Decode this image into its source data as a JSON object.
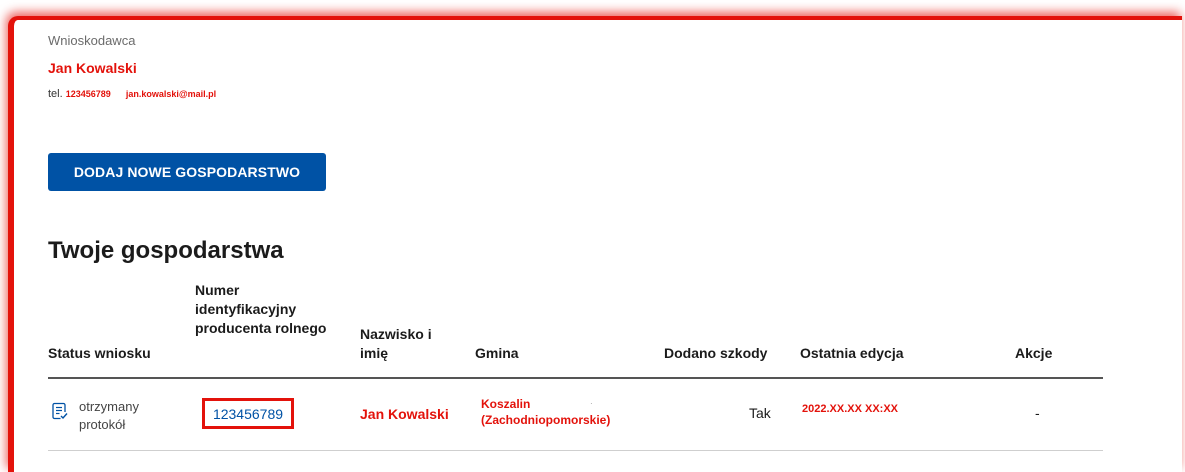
{
  "applicant": {
    "label": "Wnioskodawca",
    "name": "Jan Kowalski",
    "phone_prefix": "tel.",
    "phone": "123456789",
    "email": "jan.kowalski@mail.pl"
  },
  "add_button": {
    "label": "DODAJ NOWE GOSPODARSTWO"
  },
  "farms": {
    "title": "Twoje gospodarstwa",
    "columns": {
      "status": "Status wniosku",
      "number": "Numer identyfikacyjny producenta rolnego",
      "name": "Nazwisko i imię",
      "gmina": "Gmina",
      "damage": "Dodano szkody",
      "edit": "Ostatnia edycja",
      "actions": "Akcje"
    },
    "rows": [
      {
        "status": "otrzymany protokół",
        "number": "123456789",
        "name": "Jan Kowalski",
        "gmina": "Koszalin (Zachodniopomorskie)",
        "damage": "Tak",
        "edit": "2022.XX.XX XX:XX",
        "actions": "-"
      }
    ]
  },
  "colors": {
    "primary": "#0052a5",
    "highlight": "#e3120b",
    "text": "#1b1b1b"
  },
  "icons": {
    "status": "document-check-icon"
  }
}
